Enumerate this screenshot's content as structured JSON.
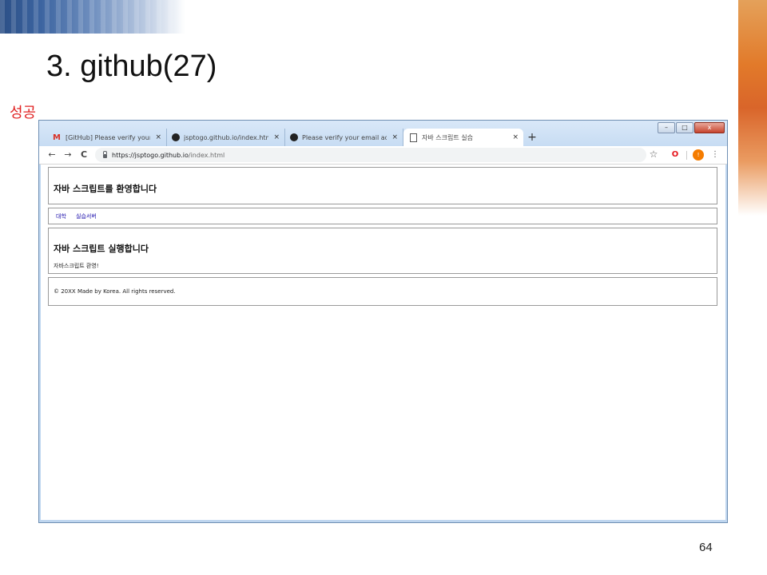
{
  "slide": {
    "title": "3. github(27)",
    "note": "성공",
    "page_number": "64"
  },
  "window_controls": {
    "minimize": "–",
    "maximize": "□",
    "close": "x"
  },
  "tabs": [
    {
      "icon": "gmail-icon",
      "label": "[GitHub] Please verify your ema",
      "close": "×"
    },
    {
      "icon": "github-icon",
      "label": "jsptogo.github.io/index.html at",
      "close": "×"
    },
    {
      "icon": "github-icon",
      "label": "Please verify your email address",
      "close": "×"
    },
    {
      "icon": "page-icon",
      "label": "자바 스크립트 실습",
      "close": "×"
    }
  ],
  "new_tab": "+",
  "toolbar": {
    "back": "←",
    "forward": "→",
    "reload": "C",
    "url_host": "https://jsptogo.github.io",
    "url_path": "/index.html",
    "star": "☆",
    "opera": "O",
    "avatar": "!",
    "menu": "⋮"
  },
  "page": {
    "header_title": "자바 스크립트를 환영합니다",
    "nav_links": [
      "대학",
      "실습서버"
    ],
    "section_title": "자바 스크립트 실행합니다",
    "section_text": "자바스크립트 환영!",
    "footer": "© 20XX Made by Korea. All rights reserved."
  },
  "colors": {
    "note": "#e02020",
    "link": "#1a0dab",
    "window_frame": "#bfd6ef",
    "accent_blue": "#2b4f86",
    "accent_orange": "#e27a2a"
  }
}
